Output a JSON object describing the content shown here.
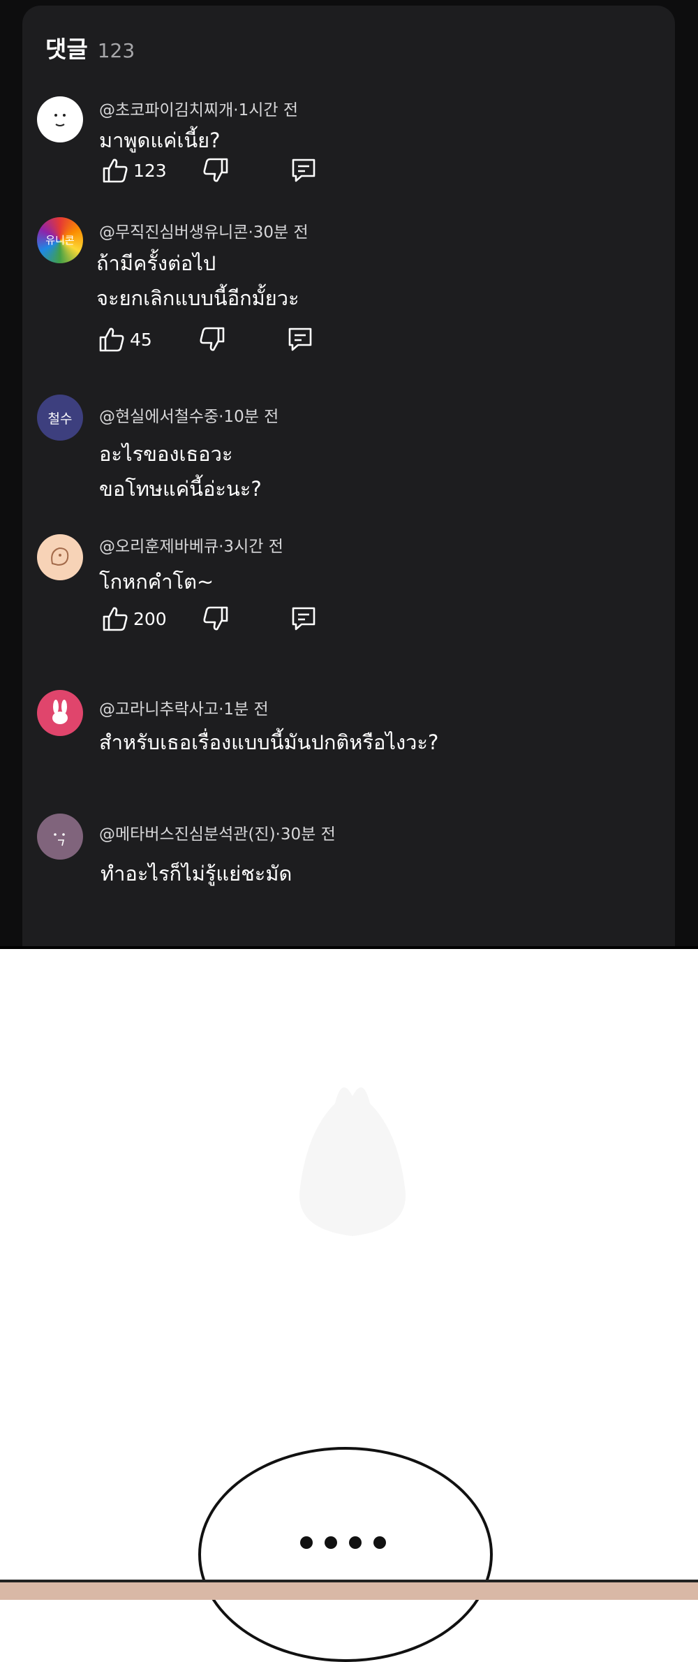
{
  "header": {
    "title": "댓글",
    "count": "123"
  },
  "comments": [
    {
      "author": "@초코파이김치찌개·1시간 전",
      "lines": [
        "มาพูดแค่เนี้ย?"
      ],
      "likes": "123"
    },
    {
      "author": "@무직진심버생유니콘·30분 전",
      "lines": [
        "ถ้ามีครั้งต่อไป",
        "จะยกเลิกแบบนี้อีกมั้ยวะ"
      ],
      "likes": "45"
    },
    {
      "author": "@현실에서철수중·10분 전",
      "lines": [
        "อะไรของเธอวะ",
        "ขอโทษแค่นี้อ่ะนะ?"
      ],
      "avatar_text": "철수"
    },
    {
      "author": "@오리훈제바베큐·3시간 전",
      "lines": [
        "โกหกคำโต~"
      ],
      "likes": "200"
    },
    {
      "author": "@고라니추락사고·1분 전",
      "lines": [
        "สำหรับเธอเรื่องแบบนี้มันปกติหรือไงวะ?"
      ]
    },
    {
      "author": "@메타버스진심분석관(진)·30분 전",
      "lines": [
        "ทำอะไรก็ไม่รู้แย่ชะมัด"
      ]
    }
  ],
  "avatar_badge": "유니콘",
  "colors": {
    "panel": "#1d1d1f",
    "avatar_purple": "#3d3f7e",
    "avatar_pink": "#e0456c",
    "avatar_mauve": "#80647c"
  },
  "icons": [
    "thumbs-up-icon",
    "thumbs-down-icon",
    "reply-icon"
  ]
}
